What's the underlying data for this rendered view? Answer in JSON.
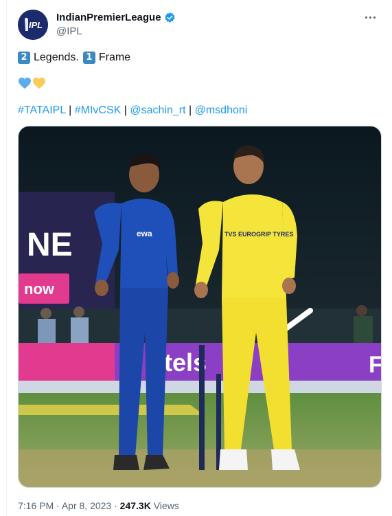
{
  "tweet": {
    "display_name": "IndianPremierLeague",
    "handle": "@IPL",
    "avatar_text": "IPL",
    "line1": {
      "num1": "2",
      "word1": "Legends.",
      "num2": "1",
      "word2": "Frame"
    },
    "hearts": [
      "blue-heart",
      "yellow-heart"
    ],
    "tags": [
      "#TATAIPL",
      "#MIvCSK",
      "@sachin_rt",
      "@msdhoni"
    ],
    "separator": "|",
    "time": "7:16 PM",
    "dot": "·",
    "date": "Apr 8, 2023",
    "views_count": "247.3K",
    "views_label": "Views"
  },
  "photo": {
    "jersey_left_brand": "ewa",
    "jersey_right_brand": "TVS EUROGRIP TYRES",
    "board_left": "NE",
    "board_left2": "now",
    "board_mid": "otels",
    "board_right": "F"
  },
  "colors": {
    "link": "#1d9bf0",
    "muted": "#536471",
    "mi_blue": "#1f4fb8",
    "csk_yellow": "#f5e43a"
  }
}
